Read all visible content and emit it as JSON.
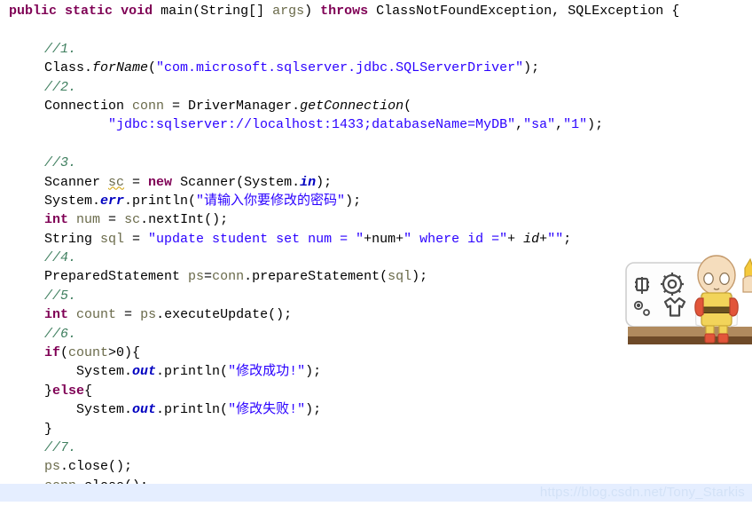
{
  "editor": {
    "background_color": "#ffffff",
    "keyword_color": "#7f0055",
    "comment_color": "#3f7f5f",
    "string_color": "#2a00ff",
    "field_color": "#0000c0",
    "lines": [
      {
        "id": "method-signature",
        "indent": "sig",
        "tokens": [
          {
            "t": "public",
            "c": "kw"
          },
          {
            "t": " ",
            "c": "plain"
          },
          {
            "t": "static",
            "c": "kw"
          },
          {
            "t": " ",
            "c": "plain"
          },
          {
            "t": "void",
            "c": "kw"
          },
          {
            "t": " main(String[] ",
            "c": "plain"
          },
          {
            "t": "args",
            "c": "ident"
          },
          {
            "t": ") ",
            "c": "plain"
          },
          {
            "t": "throws",
            "c": "kw"
          },
          {
            "t": " ClassNotFoundException, SQLException {",
            "c": "plain"
          }
        ]
      },
      {
        "id": "blank-1",
        "indent": "body",
        "tokens": []
      },
      {
        "id": "comment-1",
        "indent": "body",
        "tokens": [
          {
            "t": "//1.",
            "c": "cmt"
          }
        ]
      },
      {
        "id": "class-forname",
        "indent": "body",
        "tokens": [
          {
            "t": "Class.",
            "c": "plain"
          },
          {
            "t": "forName",
            "c": "meth"
          },
          {
            "t": "(",
            "c": "plain"
          },
          {
            "t": "\"com.microsoft.sqlserver.jdbc.SQLServerDriver\"",
            "c": "str"
          },
          {
            "t": ");",
            "c": "plain"
          }
        ]
      },
      {
        "id": "comment-2",
        "indent": "body",
        "tokens": [
          {
            "t": "//2.",
            "c": "cmt"
          }
        ]
      },
      {
        "id": "connection-decl",
        "indent": "body",
        "tokens": [
          {
            "t": "Connection ",
            "c": "plain"
          },
          {
            "t": "conn",
            "c": "ident"
          },
          {
            "t": " = DriverManager.",
            "c": "plain"
          },
          {
            "t": "getConnection",
            "c": "meth"
          },
          {
            "t": "(",
            "c": "plain"
          }
        ]
      },
      {
        "id": "connection-url",
        "indent": "body",
        "tokens": [
          {
            "t": "        ",
            "c": "plain"
          },
          {
            "t": "\"jdbc:sqlserver://localhost:1433;databaseName=MyDB\"",
            "c": "str"
          },
          {
            "t": ",",
            "c": "plain"
          },
          {
            "t": "\"sa\"",
            "c": "str"
          },
          {
            "t": ",",
            "c": "plain"
          },
          {
            "t": "\"1\"",
            "c": "str"
          },
          {
            "t": ");",
            "c": "plain"
          }
        ]
      },
      {
        "id": "blank-2",
        "indent": "body",
        "tokens": []
      },
      {
        "id": "comment-3",
        "indent": "body",
        "tokens": [
          {
            "t": "//3.",
            "c": "cmt"
          }
        ]
      },
      {
        "id": "scanner-decl",
        "indent": "body",
        "tokens": [
          {
            "t": "Scanner ",
            "c": "plain"
          },
          {
            "t": "sc",
            "c": "ident squiggle"
          },
          {
            "t": " = ",
            "c": "plain"
          },
          {
            "t": "new",
            "c": "kw"
          },
          {
            "t": " Scanner(System.",
            "c": "plain"
          },
          {
            "t": "in",
            "c": "field"
          },
          {
            "t": ");",
            "c": "plain"
          }
        ]
      },
      {
        "id": "prompt-println",
        "indent": "body",
        "tokens": [
          {
            "t": "System.",
            "c": "plain"
          },
          {
            "t": "err",
            "c": "field"
          },
          {
            "t": ".println(",
            "c": "plain"
          },
          {
            "t": "\"请输入你要修改的密码\"",
            "c": "str"
          },
          {
            "t": ");",
            "c": "plain"
          }
        ]
      },
      {
        "id": "num-decl",
        "indent": "body",
        "tokens": [
          {
            "t": "int",
            "c": "kw"
          },
          {
            "t": " ",
            "c": "plain"
          },
          {
            "t": "num",
            "c": "ident"
          },
          {
            "t": " = ",
            "c": "plain"
          },
          {
            "t": "sc",
            "c": "ident"
          },
          {
            "t": ".nextInt();",
            "c": "plain"
          }
        ]
      },
      {
        "id": "sql-decl",
        "indent": "body",
        "tokens": [
          {
            "t": "String ",
            "c": "plain"
          },
          {
            "t": "sql",
            "c": "ident"
          },
          {
            "t": " = ",
            "c": "plain"
          },
          {
            "t": "\"update student set num = \"",
            "c": "str"
          },
          {
            "t": "+num+",
            "c": "plain"
          },
          {
            "t": "\" where id =\"",
            "c": "str"
          },
          {
            "t": "+ ",
            "c": "plain"
          },
          {
            "t": "id",
            "c": "localvar"
          },
          {
            "t": "+",
            "c": "plain"
          },
          {
            "t": "\"\"",
            "c": "str"
          },
          {
            "t": ";",
            "c": "plain"
          }
        ]
      },
      {
        "id": "comment-4",
        "indent": "body",
        "tokens": [
          {
            "t": "//4.",
            "c": "cmt"
          }
        ]
      },
      {
        "id": "preparedstatement-decl",
        "indent": "body",
        "tokens": [
          {
            "t": "PreparedStatement ",
            "c": "plain"
          },
          {
            "t": "ps",
            "c": "ident"
          },
          {
            "t": "=",
            "c": "plain"
          },
          {
            "t": "conn",
            "c": "ident"
          },
          {
            "t": ".prepareStatement(",
            "c": "plain"
          },
          {
            "t": "sql",
            "c": "ident"
          },
          {
            "t": ");",
            "c": "plain"
          }
        ]
      },
      {
        "id": "comment-5",
        "indent": "body",
        "tokens": [
          {
            "t": "//5.",
            "c": "cmt"
          }
        ]
      },
      {
        "id": "count-decl",
        "indent": "body",
        "tokens": [
          {
            "t": "int",
            "c": "kw"
          },
          {
            "t": " ",
            "c": "plain"
          },
          {
            "t": "count",
            "c": "ident"
          },
          {
            "t": " = ",
            "c": "plain"
          },
          {
            "t": "ps",
            "c": "ident"
          },
          {
            "t": ".executeUpdate();",
            "c": "plain"
          }
        ]
      },
      {
        "id": "comment-6",
        "indent": "body",
        "tokens": [
          {
            "t": "//6.",
            "c": "cmt"
          }
        ]
      },
      {
        "id": "if-statement",
        "indent": "body",
        "tokens": [
          {
            "t": "if",
            "c": "kw"
          },
          {
            "t": "(",
            "c": "plain"
          },
          {
            "t": "count",
            "c": "ident"
          },
          {
            "t": ">0){",
            "c": "plain"
          }
        ]
      },
      {
        "id": "success-println",
        "indent": "body",
        "tokens": [
          {
            "t": "    System.",
            "c": "plain"
          },
          {
            "t": "out",
            "c": "field"
          },
          {
            "t": ".println(",
            "c": "plain"
          },
          {
            "t": "\"修改成功!\"",
            "c": "str"
          },
          {
            "t": ");",
            "c": "plain"
          }
        ]
      },
      {
        "id": "else-statement",
        "indent": "body",
        "tokens": [
          {
            "t": "}",
            "c": "plain"
          },
          {
            "t": "else",
            "c": "kw"
          },
          {
            "t": "{",
            "c": "plain"
          }
        ]
      },
      {
        "id": "failure-println",
        "indent": "body",
        "tokens": [
          {
            "t": "    System.",
            "c": "plain"
          },
          {
            "t": "out",
            "c": "field"
          },
          {
            "t": ".println(",
            "c": "plain"
          },
          {
            "t": "\"修改失败!\"",
            "c": "str"
          },
          {
            "t": ");",
            "c": "plain"
          }
        ]
      },
      {
        "id": "close-brace",
        "indent": "body",
        "tokens": [
          {
            "t": "}",
            "c": "plain"
          }
        ]
      },
      {
        "id": "comment-7",
        "indent": "body",
        "tokens": [
          {
            "t": "//7.",
            "c": "cmt"
          }
        ]
      },
      {
        "id": "ps-close",
        "indent": "body",
        "tokens": [
          {
            "t": "ps",
            "c": "ident"
          },
          {
            "t": ".close();",
            "c": "plain"
          }
        ]
      },
      {
        "id": "conn-close",
        "indent": "body",
        "tokens": [
          {
            "t": "conn",
            "c": "ident"
          },
          {
            "t": ".close();",
            "c": "plain"
          }
        ]
      }
    ]
  },
  "status_band": {
    "background_color": "#e5eeff",
    "watermark": "https://blog.csdn.net/Tony_Starkis",
    "watermark_color": "#d3e2f7"
  },
  "illustration": {
    "name": "saitama-shop-sprite",
    "description": "chibi bald hero in yellow suit with red gloves and boots standing on a wooden shelf beside a shop menu panel",
    "panel_icons": [
      "speaker-icon",
      "gear-icon",
      "dot-icon",
      "shirt-icon"
    ],
    "colors": {
      "suit": "#f2d45a",
      "gloves": "#e2553a",
      "boots": "#e2553a",
      "cape": "#fdfdfd",
      "skin": "#f5ddbd",
      "shelf_top": "#b08a5e",
      "shelf_front": "#6e4a28",
      "panel": "#fdfdfd",
      "panel_border": "#cfcfcf",
      "second_character_hair": "#f5c93c"
    }
  }
}
